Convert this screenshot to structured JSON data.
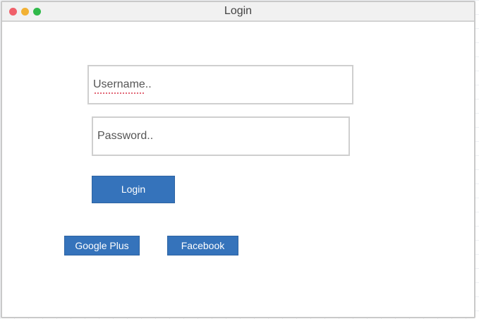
{
  "window": {
    "title": "Login"
  },
  "login_form": {
    "username_placeholder": "Username..",
    "password_placeholder": "Password..",
    "login_button": "Login"
  },
  "social": {
    "google_button": "Google Plus",
    "facebook_button": "Facebook"
  },
  "colors": {
    "button_bg": "#3573bb",
    "close": "#f0606a",
    "minimize": "#f2b134",
    "zoom": "#30b94a"
  }
}
